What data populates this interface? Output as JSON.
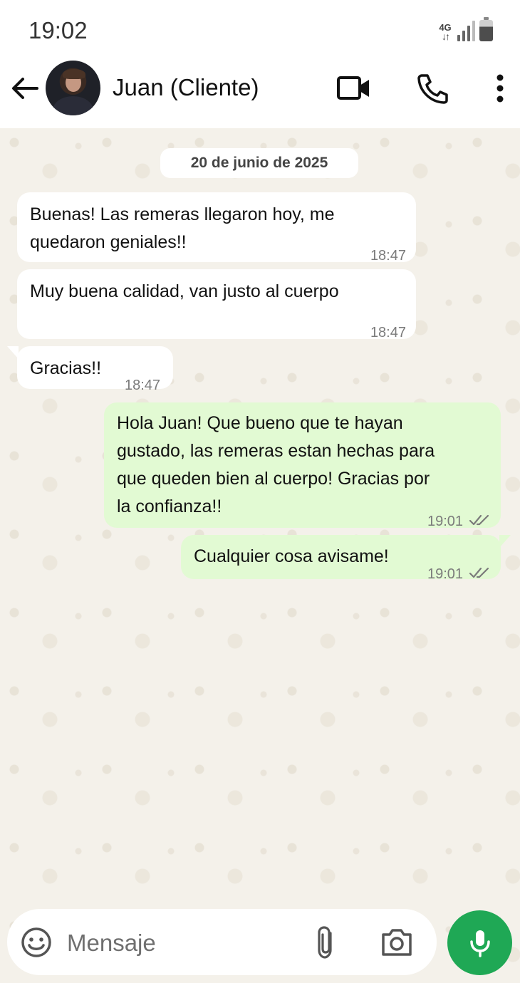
{
  "status_bar": {
    "time": "19:02",
    "network": "4G"
  },
  "header": {
    "contact_name": "Juan (Cliente)",
    "icons": [
      "back-arrow-icon",
      "video-call-icon",
      "phone-icon",
      "more-vert-icon"
    ]
  },
  "chat": {
    "date_separator": "20 de junio de 2025",
    "messages": [
      {
        "direction": "incoming",
        "lines": [
          "Buenas! Las remeras llegaron hoy, me",
          "quedaron geniales!!"
        ],
        "time": "18:47"
      },
      {
        "direction": "incoming",
        "lines": [
          "Muy buena calidad, van justo al cuerpo"
        ],
        "time": "18:47"
      },
      {
        "direction": "incoming",
        "lines": [
          "Gracias!!"
        ],
        "time": "18:47"
      },
      {
        "direction": "outgoing",
        "lines": [
          "Hola Juan! Que bueno que te hayan",
          "gustado, las remeras estan hechas para",
          "que queden bien al cuerpo! Gracias por",
          "la confianza!!"
        ],
        "time": "19:01",
        "status": "read"
      },
      {
        "direction": "outgoing",
        "lines": [
          "Cualquier cosa avisame!"
        ],
        "time": "19:01",
        "status": "read"
      }
    ]
  },
  "composer": {
    "placeholder": "Mensaje",
    "value": ""
  },
  "colors": {
    "incoming_bubble": "#ffffff",
    "outgoing_bubble": "#e2fad3",
    "chat_background": "#f4f1ea",
    "mic_button": "#1fa855",
    "read_ticks": "#7b7b7b"
  }
}
